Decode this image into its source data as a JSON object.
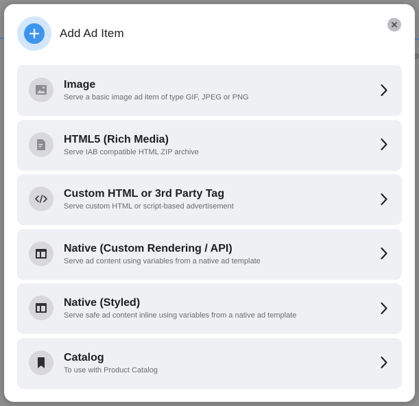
{
  "modal": {
    "title": "Add Ad Item",
    "header_icon": "plus-icon",
    "close_icon": "close-icon",
    "colors": {
      "accent": "#3d95ee",
      "accent_light": "#d3e6fb",
      "item_bg": "#eff0f4"
    }
  },
  "background": {
    "edge_text": "p"
  },
  "items": [
    {
      "icon": "image-icon",
      "title": "Image",
      "description": "Serve a basic image ad item of type GIF, JPEG or PNG"
    },
    {
      "icon": "document-icon",
      "title": "HTML5 (Rich Media)",
      "description": "Serve IAB compatible HTML ZIP archive"
    },
    {
      "icon": "code-icon",
      "title": "Custom HTML or 3rd Party Tag",
      "description": "Serve custom HTML or script-based advertisement"
    },
    {
      "icon": "layout-icon",
      "title": "Native (Custom Rendering / API)",
      "description": "Serve ad content using variables from a native ad template"
    },
    {
      "icon": "layout-icon",
      "title": "Native (Styled)",
      "description": "Serve safe ad content inline using variables from a native ad template"
    },
    {
      "icon": "bookmark-icon",
      "title": "Catalog",
      "description": "To use with Product Catalog"
    }
  ]
}
